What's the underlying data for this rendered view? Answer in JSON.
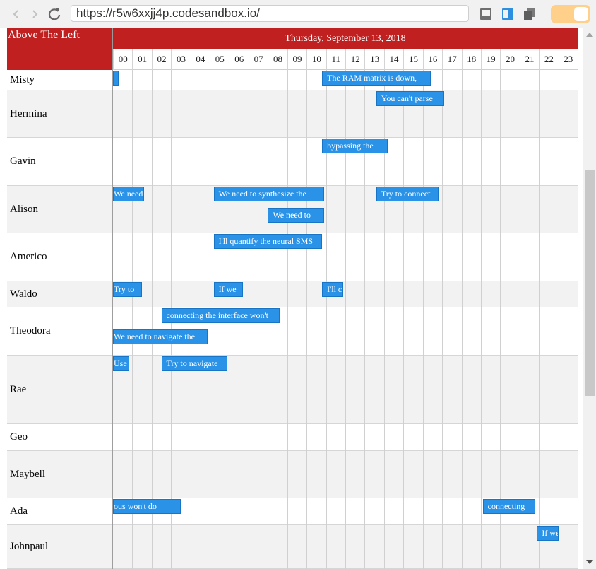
{
  "browser": {
    "url": "https://r5w6xxjj4p.codesandbox.io/"
  },
  "scheduler": {
    "corner_label": "Above The Left",
    "date_label": "Thursday, September 13, 2018",
    "hours": [
      "00",
      "01",
      "02",
      "03",
      "04",
      "05",
      "06",
      "07",
      "08",
      "09",
      "10",
      "11",
      "12",
      "13",
      "14",
      "15",
      "16",
      "17",
      "18",
      "19",
      "20",
      "21",
      "22",
      "23"
    ],
    "rows": [
      {
        "name": "Misty",
        "events": [
          {
            "label": "",
            "start": 0,
            "end": 0.3,
            "lane": 0
          },
          {
            "label": "The RAM matrix is down,",
            "start": 10.8,
            "end": 16.4,
            "lane": 0
          }
        ]
      },
      {
        "name": "Hermina",
        "events": [
          {
            "label": "You can't parse",
            "start": 13.6,
            "end": 17.1,
            "lane": 0
          }
        ]
      },
      {
        "name": "Gavin",
        "events": [
          {
            "label": "bypassing the",
            "start": 10.8,
            "end": 14.2,
            "lane": 0
          }
        ]
      },
      {
        "name": "Alison",
        "events": [
          {
            "label": "We need to",
            "start": 0,
            "end": 1.6,
            "lane": 0
          },
          {
            "label": "We need to synthesize the",
            "start": 5.2,
            "end": 10.9,
            "lane": 0
          },
          {
            "label": "Try to connect",
            "start": 13.6,
            "end": 16.8,
            "lane": 0
          },
          {
            "label": "We need to",
            "start": 8.0,
            "end": 10.9,
            "lane": 1
          }
        ]
      },
      {
        "name": "Americo",
        "events": [
          {
            "label": "I'll quantify the neural SMS",
            "start": 5.2,
            "end": 10.8,
            "lane": 0
          }
        ]
      },
      {
        "name": "Waldo",
        "events": [
          {
            "label": "Try to",
            "start": 0,
            "end": 1.5,
            "lane": 0
          },
          {
            "label": "If we",
            "start": 5.2,
            "end": 6.7,
            "lane": 0
          },
          {
            "label": "I'll copy",
            "start": 10.8,
            "end": 11.9,
            "lane": 0
          }
        ]
      },
      {
        "name": "Theodora",
        "events": [
          {
            "label": "connecting the interface won't",
            "start": 2.5,
            "end": 8.6,
            "lane": 0
          },
          {
            "label": "We need to navigate the",
            "start": 0,
            "end": 4.9,
            "lane": 1
          }
        ]
      },
      {
        "name": "Rae",
        "events": [
          {
            "label": "Use the",
            "start": 0,
            "end": 0.85,
            "lane": 0
          },
          {
            "label": "Try to navigate",
            "start": 2.5,
            "end": 5.9,
            "lane": 0
          }
        ]
      },
      {
        "name": "Geo",
        "events": []
      },
      {
        "name": "Maybell",
        "events": []
      },
      {
        "name": "Ada",
        "events": [
          {
            "label": "ous won't do",
            "start": 0,
            "end": 3.5,
            "lane": 0
          },
          {
            "label": "connecting",
            "start": 19.1,
            "end": 21.8,
            "lane": 0
          }
        ]
      },
      {
        "name": "Johnpaul",
        "events": [
          {
            "label": "If we",
            "start": 21.9,
            "end": 23.0,
            "lane": 0
          }
        ]
      }
    ]
  }
}
